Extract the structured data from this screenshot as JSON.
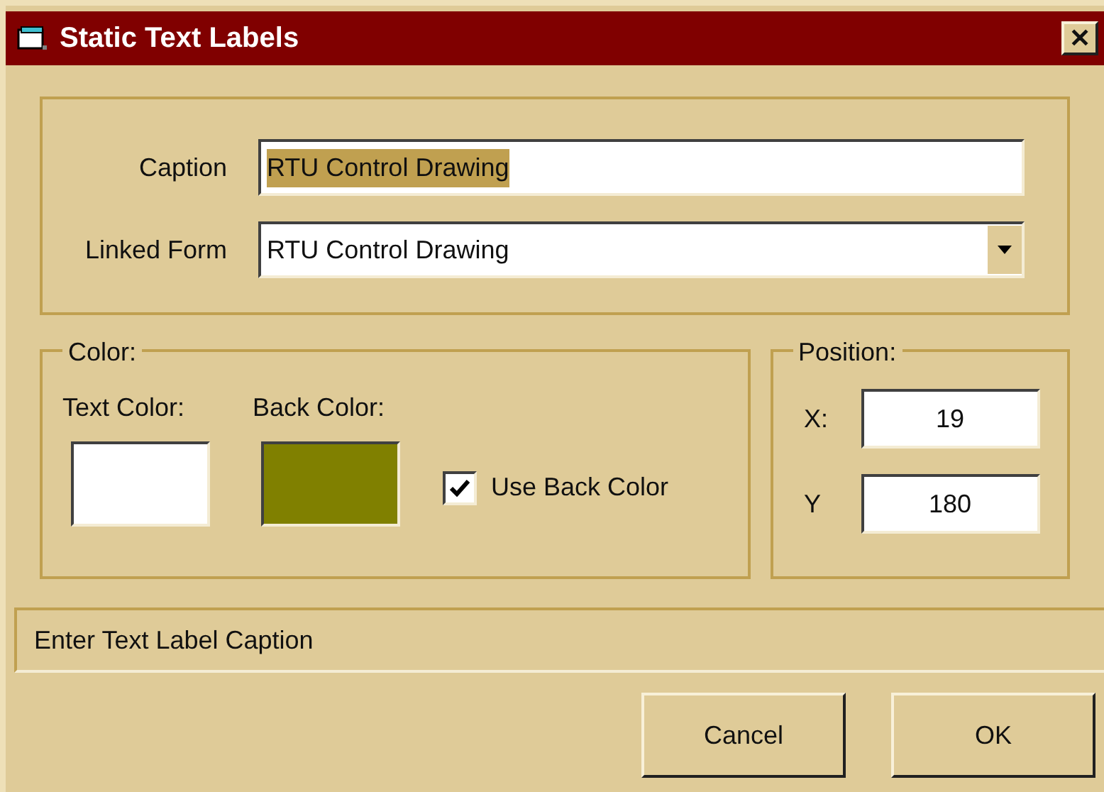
{
  "window": {
    "title": "Static Text Labels",
    "close": "✕"
  },
  "caption": {
    "label": "Caption",
    "value": "RTU Control Drawing",
    "text_selected": true
  },
  "linked_form": {
    "label": "Linked Form",
    "value": "RTU Control Drawing"
  },
  "color_group": {
    "title": "Color:",
    "swatches": [
      {
        "label": "Text Color:",
        "color": "#ffffff"
      },
      {
        "label": "Back Color:",
        "color": "#808000"
      }
    ],
    "use_back_color": {
      "label": "Use Back Color",
      "checked": true
    }
  },
  "position_group": {
    "title": "Position:",
    "fields": [
      {
        "label": "X:",
        "value": "19"
      },
      {
        "label": "Y",
        "value": "180"
      }
    ]
  },
  "status_bar": "Enter Text Label Caption",
  "buttons": [
    "Cancel",
    "OK"
  ]
}
